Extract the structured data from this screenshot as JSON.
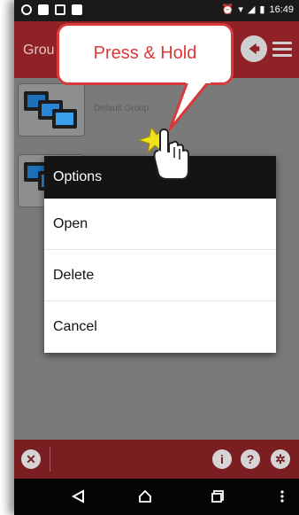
{
  "status_bar": {
    "time": "16:49"
  },
  "app_bar": {
    "title": "Grou",
    "icons": [
      "back-circle-icon",
      "hamburger-menu-icon"
    ]
  },
  "groups": [
    {
      "name": "Default Group"
    },
    {
      "name": ""
    }
  ],
  "callout": {
    "text": "Press & Hold"
  },
  "options_dialog": {
    "title": "Options",
    "items": [
      "Open",
      "Delete",
      "Cancel"
    ]
  },
  "bottom_bar": {
    "icons": [
      "close-circle-icon",
      "info-icon",
      "help-icon",
      "settings-icon"
    ]
  },
  "nav_bar": {
    "icons": [
      "back-nav-icon",
      "home-nav-icon",
      "recents-nav-icon",
      "overflow-nav-icon"
    ]
  },
  "colors": {
    "app_bar": "#8e2226",
    "bottom_bar": "#7a1e22",
    "callout_accent": "#d83a3a",
    "dialog_header": "#141414"
  }
}
